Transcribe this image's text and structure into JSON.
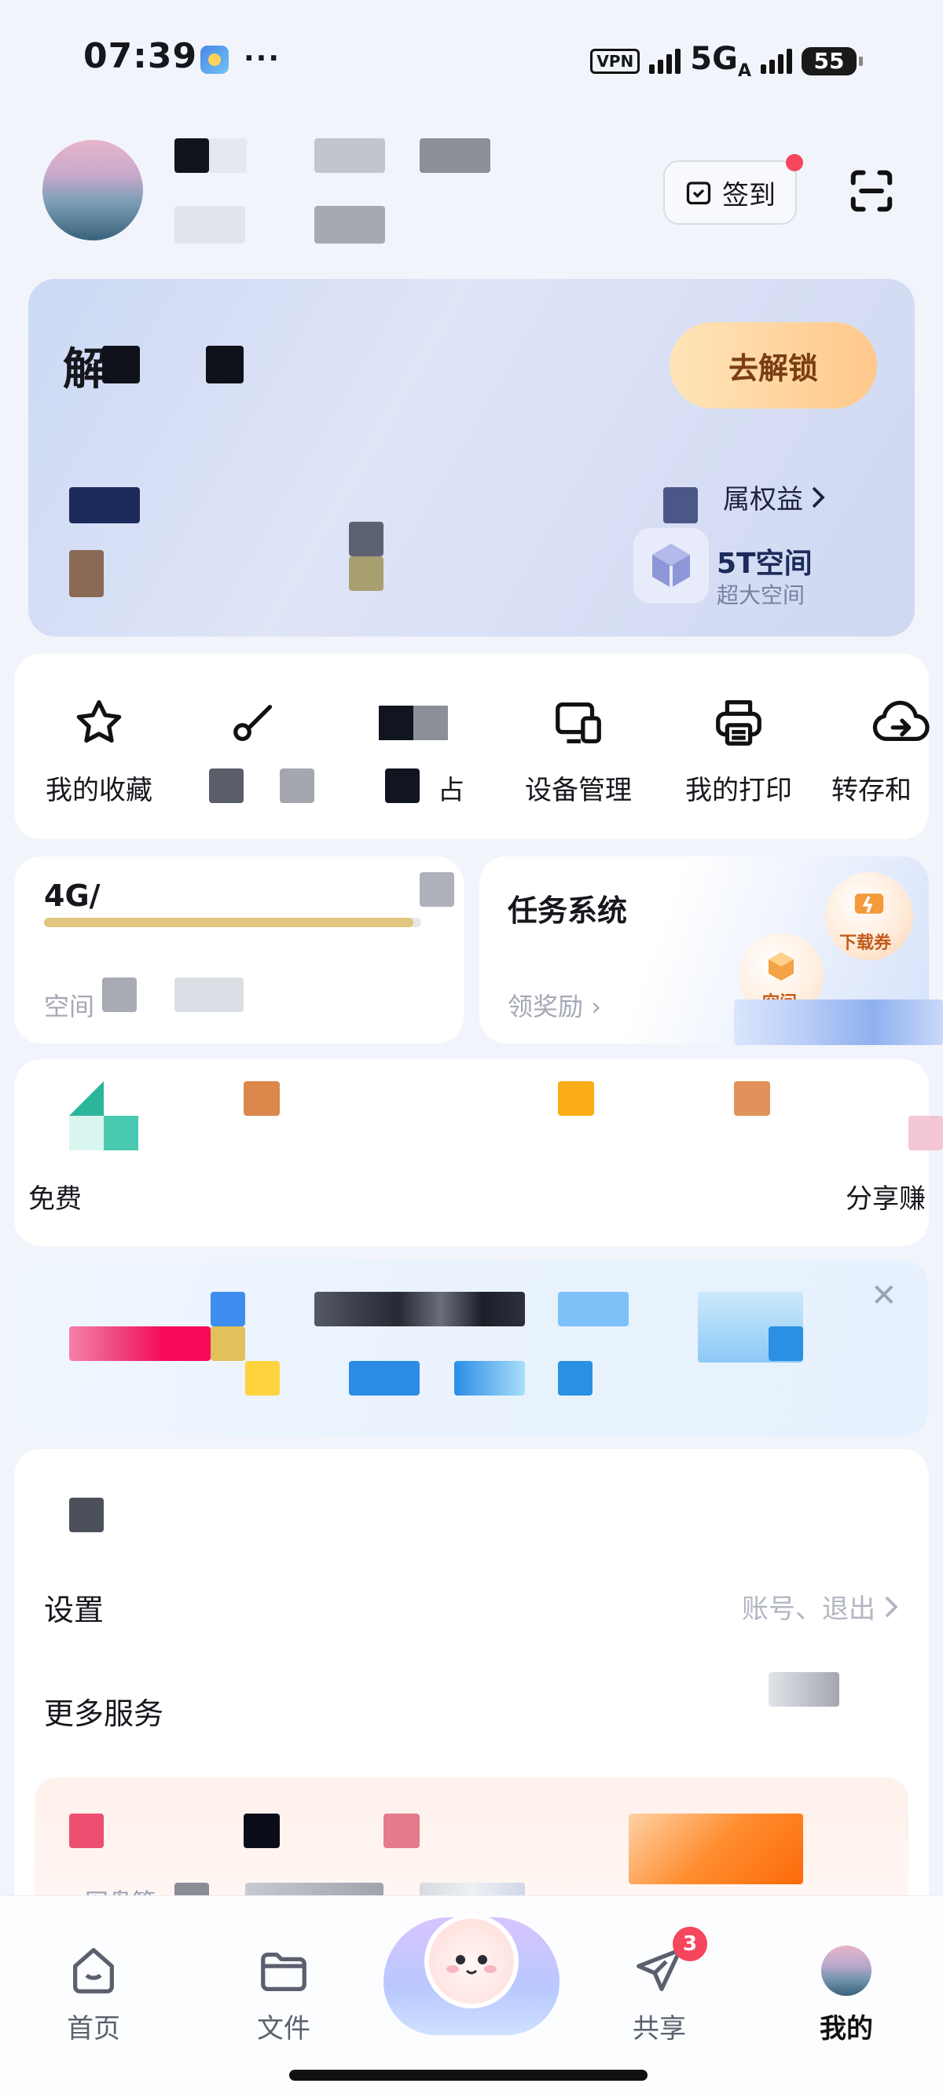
{
  "status_bar": {
    "time": "07:39",
    "dots": "···",
    "vpn": "VPN",
    "network": "5G",
    "network_sub": "A",
    "battery": "55"
  },
  "profile": {
    "signin_label": "签到"
  },
  "member_card": {
    "title": "解",
    "unlock_label": "去解锁",
    "benefit_label": "属权益",
    "space_title": "5T空间",
    "space_sub": "超大空间"
  },
  "tools": [
    {
      "label": "我的收藏",
      "icon": "star-icon"
    },
    {
      "label": "",
      "icon": "link-icon"
    },
    {
      "label": "占",
      "icon": "blurred-icon"
    },
    {
      "label": "设备管理",
      "icon": "device-icon"
    },
    {
      "label": "我的打印",
      "icon": "printer-icon"
    },
    {
      "label": "转存和",
      "icon": "cloud-upload-icon"
    }
  ],
  "storage": {
    "title": "4G/",
    "sub": "空间",
    "fill_fraction": 0.98
  },
  "task": {
    "title": "任务系统",
    "sub": "领奖励",
    "ticket_label": "下载券",
    "cube_label": "空间"
  },
  "services": {
    "left_label": "免费",
    "right_label": "分享赚"
  },
  "settings": {
    "settings_label": "设置",
    "settings_hint": "账号、退出",
    "more_label": "更多服务",
    "coupon_sub": "网盘節"
  },
  "tabbar": {
    "tabs": [
      {
        "label": "首页",
        "icon": "home-icon"
      },
      {
        "label": "文件",
        "icon": "folder-icon"
      },
      {
        "label": "共享",
        "icon": "send-icon",
        "badge": "3"
      },
      {
        "label": "我的",
        "icon": "avatar-icon"
      }
    ]
  },
  "colors": {
    "accent_gold": "#e2c57e",
    "badge_red": "#f5465e",
    "unlock_text": "#7a3d12"
  }
}
